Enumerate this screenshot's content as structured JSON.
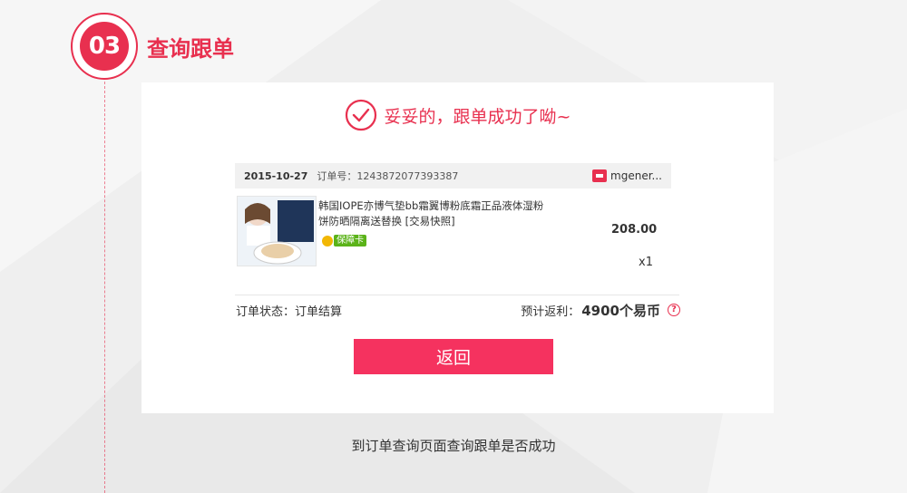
{
  "step": {
    "number": "03",
    "title": "查询跟单"
  },
  "result": {
    "success_message": "妥妥的，跟单成功了呦~"
  },
  "order": {
    "date": "2015-10-27",
    "order_no_label": "订单号：",
    "order_no": "1243872077393387",
    "shop_name": "mgener...",
    "product_name": "韩国IOPE亦博气垫bb霜翼博粉底霜正品液体湿粉饼防晒隔离送替换 [交易快照]",
    "guarantee_label": "保障卡",
    "price": "208.00",
    "quantity": "x1"
  },
  "status": {
    "label": "订单状态：订单结算",
    "rebate_label": "预计返利：",
    "rebate_value": "4900个易币",
    "help_glyph": "?"
  },
  "actions": {
    "back_label": "返回"
  },
  "caption": "到订单查询页面查询跟单是否成功",
  "colors": {
    "accent": "#e8304f",
    "button": "#f5325f",
    "page_bg": "#eeeeee"
  }
}
